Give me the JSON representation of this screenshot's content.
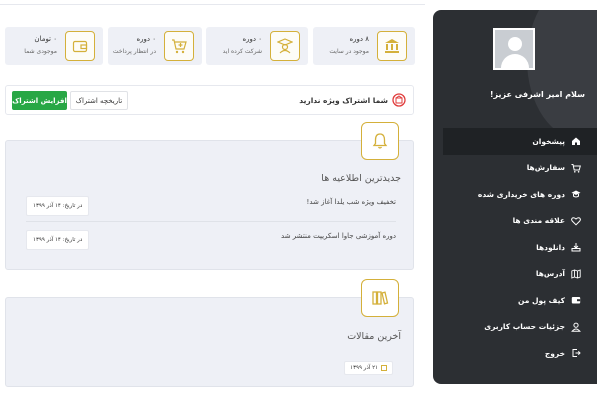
{
  "sidebar": {
    "greeting": "سلام امیر اشرفی عزیز!",
    "items": [
      {
        "label": "پیشخوان",
        "icon": "home-icon",
        "active": true
      },
      {
        "label": "سفارش‌ها",
        "icon": "cart-icon"
      },
      {
        "label": "دوره های خریداری شده",
        "icon": "graduation-cap-icon"
      },
      {
        "label": "علاقه مندی ها",
        "icon": "heart-icon"
      },
      {
        "label": "دانلودها",
        "icon": "download-icon"
      },
      {
        "label": "آدرس‌ها",
        "icon": "map-icon"
      },
      {
        "label": "کیف پول من",
        "icon": "wallet-icon"
      },
      {
        "label": "جزئیات حساب کاربری",
        "icon": "user-icon"
      },
      {
        "label": "خروج",
        "icon": "logout-icon"
      }
    ]
  },
  "stats": [
    {
      "value": "۸ دوره",
      "caption": "موجود در سایت",
      "icon": "bank-icon"
    },
    {
      "value": "۰ دوره",
      "caption": "شرکت کرده اید",
      "icon": "student-icon"
    },
    {
      "value": "۰ دوره",
      "caption": "در انتظار پرداخت",
      "icon": "cart-plus-icon"
    },
    {
      "value": "۰ تومان",
      "caption": "موجودی شما",
      "icon": "wallet-icon"
    }
  ],
  "subscription": {
    "status": "شما اشتراک ویژه ندارید",
    "history_label": "تاریخچه اشتراک",
    "upgrade_label": "افزایش اشتراک"
  },
  "notifications": {
    "title": "جدیدترین اطلاعیه ها",
    "items": [
      {
        "text": "تخفیف ویژه شب یلدا آغاز شد!",
        "date": "در تاریخ: ۱۴ آذر ۱۳۹۹"
      },
      {
        "text": "دوره آموزشی جاوا اسکریپت منتشر شد",
        "date": "در تاریخ: ۱۴ آذر ۱۳۹۹"
      }
    ]
  },
  "articles": {
    "title": "آخرین مقالات",
    "date": "۲۱ آذر ۱۳۹۹"
  },
  "colors": {
    "accent": "#d4b03a",
    "sidebar": "#2c2f33",
    "green": "#28a745",
    "panel": "#eef0f6",
    "danger": "#e03b3b"
  }
}
